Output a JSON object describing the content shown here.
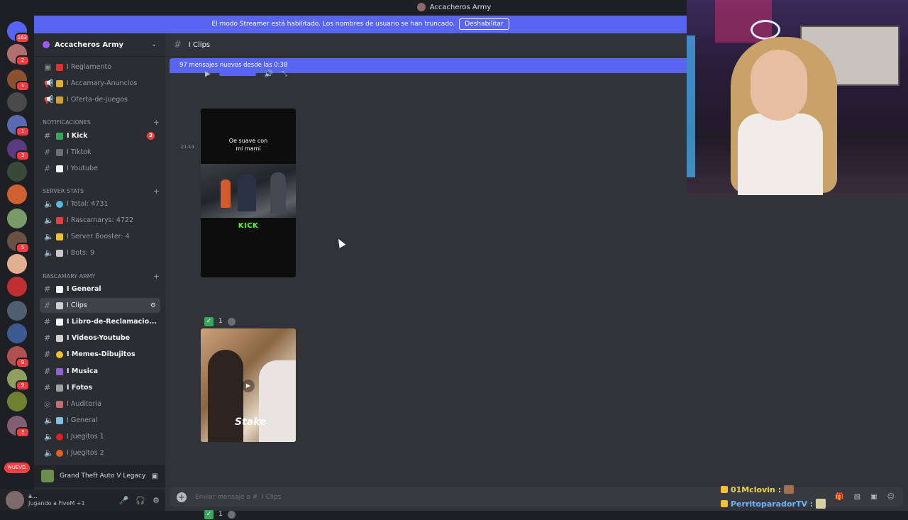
{
  "window": {
    "title": "Accacheros Army"
  },
  "guilds": {
    "top_badge": "163",
    "badges": [
      "2",
      "1",
      "1",
      "3",
      "5",
      "9",
      "9",
      "3"
    ],
    "nuevo_label": "NUEVO"
  },
  "banner": {
    "text": "El modo Streamer está habilitado. Los nombres de usuario se han truncado.",
    "button": "Deshabilitar"
  },
  "server": {
    "name": "Accacheros Army"
  },
  "channels": {
    "top": [
      {
        "name": "Reglamento"
      },
      {
        "name": "Accamary-Anuncios"
      },
      {
        "name": "Oferta-de-juegos"
      }
    ],
    "cat_notif": "NOTIFICACIONES",
    "notif": [
      {
        "name": "Kick",
        "badge": "3"
      },
      {
        "name": "Tiktok"
      },
      {
        "name": "Youtube"
      }
    ],
    "cat_stats": "SERVER STATS",
    "stats": [
      {
        "name": "Total: 4731"
      },
      {
        "name": "Rascamarys: 4722"
      },
      {
        "name": "Server Booster: 4"
      },
      {
        "name": "Bots: 9"
      }
    ],
    "cat_army": "RASCAMARY ARMY",
    "army": [
      {
        "name": "General"
      },
      {
        "name": "Clips"
      },
      {
        "name": "Libro-de-Reclamacio..."
      },
      {
        "name": "Videos-Youtube"
      },
      {
        "name": "Memes-Dibujitos"
      },
      {
        "name": "Musica"
      },
      {
        "name": "Fotos"
      },
      {
        "name": "Auditoria"
      },
      {
        "name": "General"
      },
      {
        "name": "Juegitos 1"
      },
      {
        "name": "Juegitos 2"
      }
    ],
    "separator": "I"
  },
  "activity": {
    "game": "Grand Theft Auto V Legacy"
  },
  "user": {
    "name": "a...",
    "status": "Jugando a FiveM +1"
  },
  "main": {
    "channel_name": "Clips",
    "separator": "I",
    "new_messages": "97 mensajes nuevos desde las 0:38",
    "timestamp": "21:14",
    "reaction_count": "1",
    "video1": {
      "caption_line1": "Oe suave con",
      "caption_line2": "mi mami",
      "logo": "KICK"
    },
    "video2": {
      "brand": "Stake"
    },
    "composer_placeholder": "Enviar mensaje a #",
    "composer_channel": "I Clips"
  },
  "stream_chat": [
    {
      "user": "01Mclovin :"
    },
    {
      "user": "PerritoparadorTV :"
    }
  ],
  "colors": {
    "accent": "#5865f2",
    "banner": "#8b45e6",
    "kick_green": "#53fc18",
    "badge_red": "#f23f43"
  }
}
